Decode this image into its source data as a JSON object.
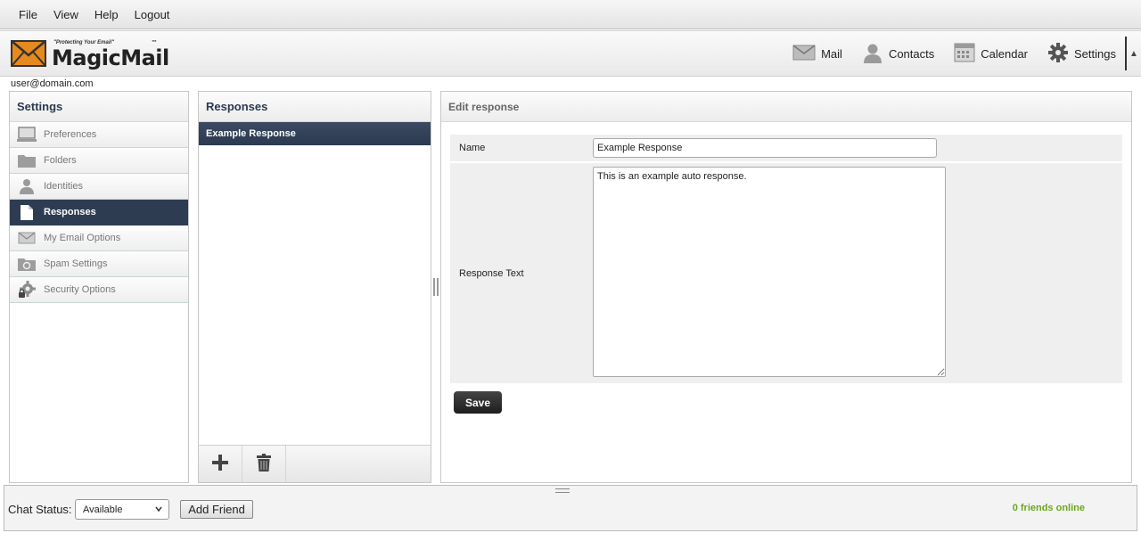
{
  "menu": {
    "items": [
      "File",
      "View",
      "Help",
      "Logout"
    ]
  },
  "logo": {
    "tagline": "\"Protecting Your Email\"",
    "name": "MagicMail",
    "tm": "™"
  },
  "topnav": {
    "items": [
      {
        "label": "Mail",
        "icon": "mail-icon"
      },
      {
        "label": "Contacts",
        "icon": "contacts-icon"
      },
      {
        "label": "Calendar",
        "icon": "calendar-icon"
      },
      {
        "label": "Settings",
        "icon": "gear-icon"
      }
    ]
  },
  "user": {
    "email": "user@domain.com"
  },
  "settings": {
    "title": "Settings",
    "items": [
      {
        "label": "Preferences",
        "icon": "monitor-icon"
      },
      {
        "label": "Folders",
        "icon": "folder-icon"
      },
      {
        "label": "Identities",
        "icon": "person-icon"
      },
      {
        "label": "Responses",
        "icon": "document-icon",
        "active": true
      },
      {
        "label": "My Email Options",
        "icon": "envelope-icon"
      },
      {
        "label": "Spam Settings",
        "icon": "spam-folder-icon"
      },
      {
        "label": "Security Options",
        "icon": "security-gear-icon"
      }
    ]
  },
  "responses": {
    "title": "Responses",
    "items": [
      "Example Response"
    ]
  },
  "edit": {
    "title": "Edit response",
    "name_label": "Name",
    "name_value": "Example Response",
    "text_label": "Response Text",
    "text_value": "This is an example auto response.",
    "save_label": "Save"
  },
  "chat": {
    "status_label": "Chat Status:",
    "status_value": "Available",
    "add_friend_label": "Add Friend",
    "friends_online": "0 friends online",
    "friends_color": "#6aa81e"
  },
  "colors": {
    "active_bg": "#2e3c52",
    "header_text": "#2b3a52"
  }
}
